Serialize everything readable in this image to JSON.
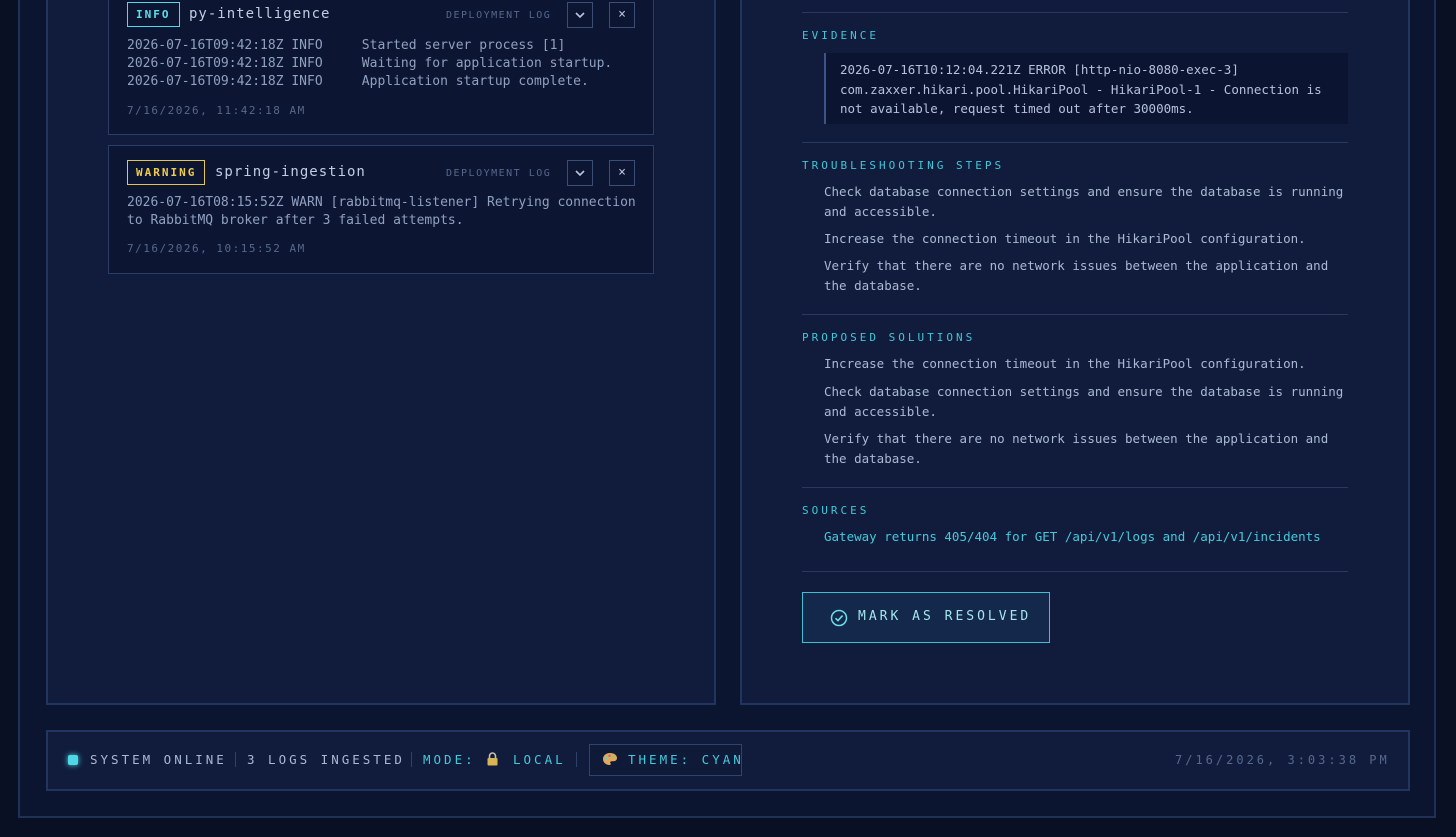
{
  "logs": [
    {
      "level": "INFO",
      "service": "py-intelligence",
      "source_label": "DEPLOYMENT LOG",
      "lines": [
        "2026-07-16T09:42:18Z INFO     Started server process [1]",
        "2026-07-16T09:42:18Z INFO     Waiting for application startup.",
        "2026-07-16T09:42:18Z INFO     Application startup complete."
      ],
      "timestamp": "7/16/2026, 11:42:18 AM"
    },
    {
      "level": "WARNING",
      "service": "spring-ingestion",
      "source_label": "DEPLOYMENT LOG",
      "message": "2026-07-16T08:15:52Z WARN [rabbitmq-listener] Retrying connection to RabbitMQ broker after 3 failed attempts.",
      "timestamp": "7/16/2026, 10:15:52 AM"
    }
  ],
  "colors": {
    "accent": "#4fd8e6",
    "warning": "#f0cc4e",
    "background": "#0a1024",
    "panel": "#111c3c"
  },
  "analysis": {
    "evidence_title": "EVIDENCE",
    "evidence_text": "2026-07-16T10:12:04.221Z ERROR [http-nio-8080-exec-3] com.zaxxer.hikari.pool.HikariPool - HikariPool-1 - Connection is not available, request timed out after 30000ms.",
    "troubleshooting_title": "TROUBLESHOOTING STEPS",
    "troubleshooting": [
      "Check database connection settings and ensure the database is running and accessible.",
      "Increase the connection timeout in the HikariPool configuration.",
      "Verify that there are no network issues between the application and the database."
    ],
    "solutions_title": "PROPOSED SOLUTIONS",
    "solutions": [
      "Increase the connection timeout in the HikariPool configuration.",
      "Check database connection settings and ensure the database is running and accessible.",
      "Verify that there are no network issues between the application and the database."
    ],
    "sources_title": "SOURCES",
    "sources": [
      "Gateway returns 405/404 for GET /api/v1/logs and /api/v1/incidents"
    ],
    "resolve_label": "MARK AS RESOLVED"
  },
  "status_bar": {
    "system": "SYSTEM ONLINE",
    "logs_count": "3 LOGS INGESTED",
    "mode_label": "MODE:",
    "mode_value": "LOCAL",
    "theme": "THEME: CYAN",
    "clock": "7/16/2026, 3:03:38 PM"
  },
  "icons": {
    "expand": "chevron-down-icon",
    "close": "close-icon",
    "resolve": "check-circle-icon",
    "mode": "lock-icon",
    "theme": "palette-icon",
    "status": "status-dot-icon"
  }
}
